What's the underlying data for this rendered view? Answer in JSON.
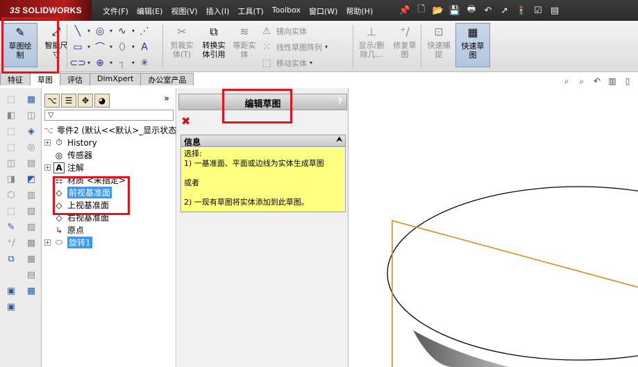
{
  "app": {
    "brand_prefix": "3S",
    "brand": "SOLIDWORKS"
  },
  "menu": [
    "文件(F)",
    "编辑(E)",
    "视图(V)",
    "插入(I)",
    "工具(T)",
    "Toolbox",
    "窗口(W)",
    "帮助(H)"
  ],
  "quick_access": [
    "pin-icon",
    "new-file-icon",
    "open-icon",
    "save-icon",
    "print-icon",
    "undo-icon",
    "select-icon",
    "rebuild-icon",
    "options-icon",
    "customize-icon"
  ],
  "commands": {
    "sketch": "草图绘\n制",
    "smart_dim": "智能尺\n寸",
    "trim": "剪裁实\n体(T)",
    "convert": "转换实\n体引用",
    "offset": "等距实\n体",
    "mirror": "镜向实体",
    "linear_pattern": "线性草图阵列",
    "move": "移动实体",
    "show_delete": "显示/删\n除几...",
    "repair": "修复草\n图",
    "quick_snap": "快速捕\n捉",
    "rapid_sketch": "快速草\n图"
  },
  "tabs": [
    "特征",
    "草图",
    "评估",
    "DimXpert",
    "办公室产品"
  ],
  "tree": {
    "more": "»",
    "root": "零件2 (默认<<默认>_显示状态",
    "items": [
      "History",
      "传感器",
      "注解",
      "材质 <未指定>",
      "前视基准面",
      "上视基准面",
      "右视基准面",
      "原点",
      "旋转1"
    ]
  },
  "pm": {
    "title": "编辑草图",
    "help": "?",
    "info_title": "信息",
    "info_toggle": "⮝",
    "info_lines": [
      "选择:",
      "1) 一基准面、平面或边线为实体生成草图",
      "",
      "或者",
      "",
      "2) 一现有草图将实体添加到此草图。"
    ]
  }
}
